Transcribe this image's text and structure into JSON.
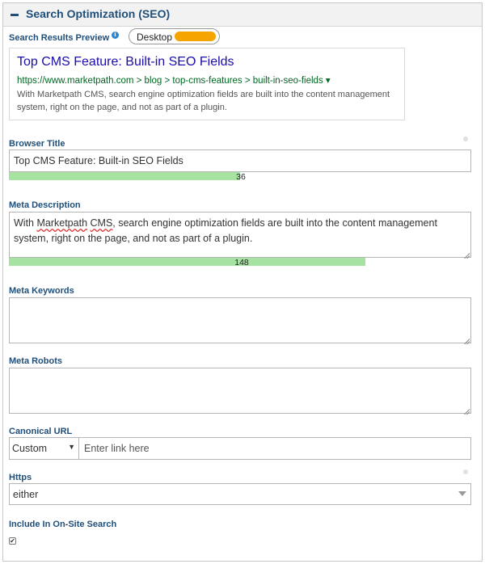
{
  "section": {
    "title": "Search Optimization (SEO)",
    "collapse_icon": "minus-icon"
  },
  "preview": {
    "label": "Search Results Preview",
    "info_icon": "info-icon",
    "device_toggle": {
      "label": "Desktop",
      "accent": "#f5a400"
    },
    "title": "Top CMS Feature: Built-in SEO Fields",
    "url": "https://www.marketpath.com > blog > top-cms-features > built-in-seo-fields ▾",
    "description": "With Marketpath CMS, search engine optimization fields are built into the content management system, right on the page, and not as part of a plugin."
  },
  "browser_title": {
    "label": "Browser Title",
    "value": "Top CMS Feature: Built-in SEO Fields",
    "char_count": "36",
    "bar_fraction": 0.5
  },
  "meta_description": {
    "label": "Meta Description",
    "value_pre": "With ",
    "value_misspelled_1": "Marketpath",
    "value_space": " ",
    "value_misspelled_2": "CMS",
    "value_post": ", search engine optimization fields are built into the content management system, right on the page, and not as part of a plugin.",
    "char_count": "148",
    "bar_fraction": 0.77
  },
  "meta_keywords": {
    "label": "Meta Keywords",
    "value": ""
  },
  "meta_robots": {
    "label": "Meta Robots",
    "value": ""
  },
  "canonical_url": {
    "label": "Canonical URL",
    "type_selected": "Custom",
    "link_placeholder": "Enter link here"
  },
  "https": {
    "label": "Https",
    "selected": "either"
  },
  "onsite_search": {
    "label": "Include In On-Site Search",
    "checked": true,
    "check_glyph": "✔"
  },
  "colors": {
    "heading": "#1f4e79",
    "link_title": "#1a0dab",
    "link_url": "#006621",
    "counter_bar": "#a6e3a1"
  }
}
